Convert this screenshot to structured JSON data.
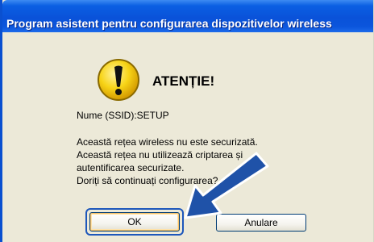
{
  "window": {
    "title": "Program asistent pentru configurarea dispozitivelor wireless"
  },
  "dialog": {
    "heading": "ATENȚIE!",
    "icon": "warning-icon",
    "ssid_line": "Nume (SSID):SETUP",
    "message_lines": [
      "Această rețea wireless nu este securizată.",
      "Această rețea nu utilizează criptarea și",
      "autentificarea securizate.",
      "Doriți să continuați configurarea?"
    ]
  },
  "buttons": {
    "ok_label": "OK",
    "cancel_label": "Anulare"
  },
  "annotation": {
    "icon": "pointer-arrow-icon",
    "color": "#1f52a8"
  },
  "colors": {
    "titlebar": "#0a52d9",
    "dialog_bg": "#ece9d8",
    "focus": "#1d57bb"
  }
}
